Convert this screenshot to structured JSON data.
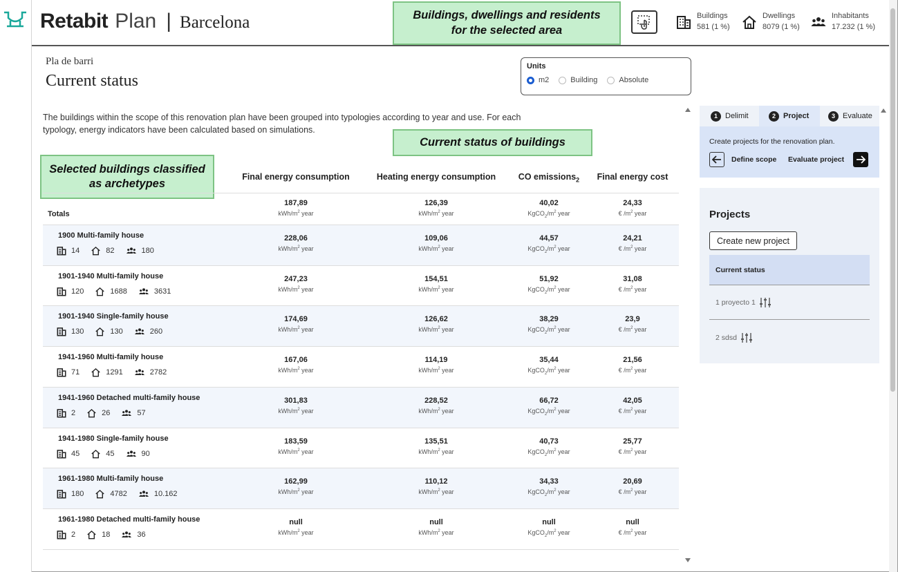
{
  "app": {
    "brand_bold": "Retabit",
    "brand_light": "Plan",
    "separator": "|",
    "city": "Barcelona"
  },
  "annotations": {
    "header_callout": "Buildings, dwellings and residents for the selected area",
    "status_callout": "Current status of buildings",
    "archetype_callout": "Selected buildings classified as archetypes"
  },
  "header_stats": [
    {
      "icon": "buildings-icon",
      "label": "Buildings",
      "value": "581 (1 %)"
    },
    {
      "icon": "dwellings-icon",
      "label": "Dwellings",
      "value": "8079 (1 %)"
    },
    {
      "icon": "inhabitants-icon",
      "label": "Inhabitants",
      "value": "17.232 (1 %)"
    }
  ],
  "page": {
    "subtitle": "Pla de barri",
    "title": "Current status",
    "intro": "The buildings within the scope of this renovation plan have been grouped into typologies according to year and use. For each typology, energy indicators have been calculated based on simulations."
  },
  "units": {
    "title": "Units",
    "options": [
      "m2",
      "Building",
      "Absolute"
    ],
    "selected": "m2"
  },
  "table": {
    "columns": [
      "Final energy consumption",
      "Heating energy consumption",
      "CO emissions",
      "Final energy cost"
    ],
    "co_subscript": "2",
    "units": {
      "kwh": "kWh/m",
      "kwh_sup": "2",
      "kwh_tail": " year",
      "co2": "KgCO",
      "co2_sub": "2",
      "co2_mid": "/m",
      "co2_sup": "2",
      "co2_tail": " year",
      "cost": "€ /m",
      "cost_sup": "2",
      "cost_tail": " year"
    },
    "totals": {
      "label": "Totals",
      "final": "187,89",
      "heating": "126,39",
      "co2": "40,02",
      "cost": "24,33"
    },
    "rows": [
      {
        "name": "1900 Multi-family house",
        "buildings": "14",
        "dwellings": "82",
        "inhabitants": "180",
        "final": "228,06",
        "heating": "109,06",
        "co2": "44,57",
        "cost": "24,21"
      },
      {
        "name": "1901-1940 Multi-family house",
        "buildings": "120",
        "dwellings": "1688",
        "inhabitants": "3631",
        "final": "247,23",
        "heating": "154,51",
        "co2": "51,92",
        "cost": "31,08"
      },
      {
        "name": "1901-1940 Single-family house",
        "buildings": "130",
        "dwellings": "130",
        "inhabitants": "260",
        "final": "174,69",
        "heating": "126,62",
        "co2": "38,29",
        "cost": "23,9"
      },
      {
        "name": "1941-1960 Multi-family house",
        "buildings": "71",
        "dwellings": "1291",
        "inhabitants": "2782",
        "final": "167,06",
        "heating": "114,19",
        "co2": "35,44",
        "cost": "21,56"
      },
      {
        "name": "1941-1960 Detached multi-family house",
        "buildings": "2",
        "dwellings": "26",
        "inhabitants": "57",
        "final": "301,83",
        "heating": "228,52",
        "co2": "66,72",
        "cost": "42,05"
      },
      {
        "name": "1941-1980 Single-family house",
        "buildings": "45",
        "dwellings": "45",
        "inhabitants": "90",
        "final": "183,59",
        "heating": "135,51",
        "co2": "40,73",
        "cost": "25,77"
      },
      {
        "name": "1961-1980 Multi-family house",
        "buildings": "180",
        "dwellings": "4782",
        "inhabitants": "10.162",
        "final": "162,99",
        "heating": "110,12",
        "co2": "34,33",
        "cost": "20,69"
      },
      {
        "name": "1961-1980 Detached multi-family house",
        "buildings": "2",
        "dwellings": "18",
        "inhabitants": "36",
        "final": "null",
        "heating": "null",
        "co2": "null",
        "cost": "null"
      }
    ]
  },
  "steps": [
    {
      "num": "1",
      "label": "Delimit"
    },
    {
      "num": "2",
      "label": "Project"
    },
    {
      "num": "3",
      "label": "Evaluate"
    }
  ],
  "active_step": "Project",
  "project_panel": {
    "text": "Create projects for the renovation plan.",
    "back_label": "Define scope",
    "next_label": "Evaluate project"
  },
  "projects": {
    "title": "Projects",
    "create_label": "Create new project",
    "current_status": "Current status",
    "items": [
      "1 proyecto 1",
      "2 sdsd"
    ]
  },
  "colors": {
    "brand_teal": "#1aa89a",
    "callout_fill": "#c6efce",
    "callout_border": "#7dc383",
    "radio_blue": "#1a5cd0",
    "panel_blue": "#d9e4f7"
  }
}
